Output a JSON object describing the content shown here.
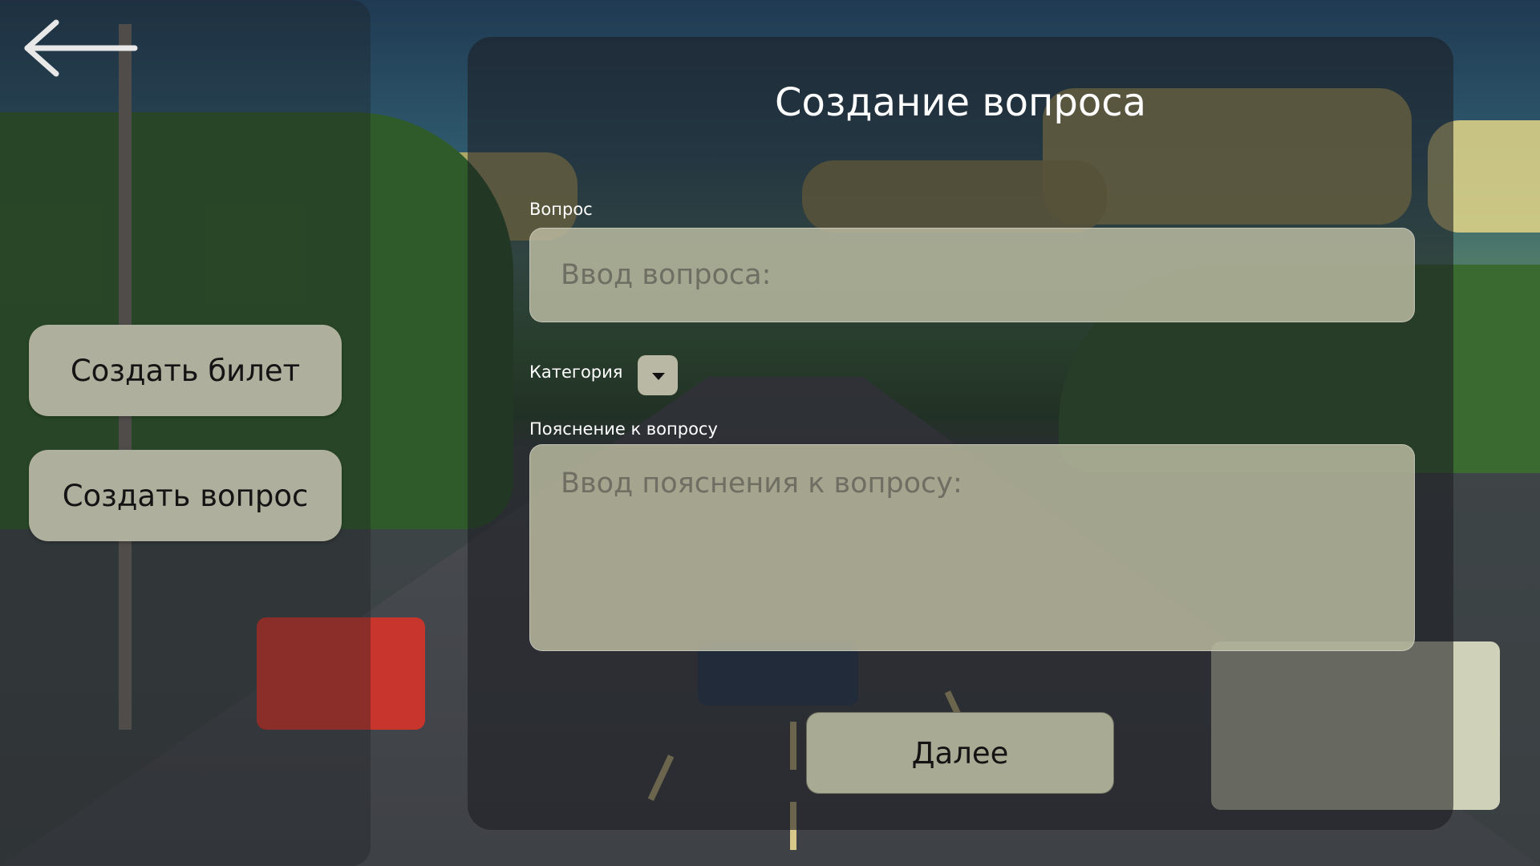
{
  "sidebar": {
    "back_icon": "arrow-left-icon",
    "buttons": [
      {
        "label": "Создать билет"
      },
      {
        "label": "Создать вопрос"
      }
    ]
  },
  "form": {
    "title": "Создание вопроса",
    "question": {
      "label": "Вопрос",
      "placeholder": "Ввод вопроса:",
      "value": ""
    },
    "category": {
      "label": "Категория",
      "dropdown_icon": "caret-down-icon"
    },
    "explanation": {
      "label": "Пояснение к вопросу",
      "placeholder": "Ввод пояснения к вопросу:",
      "value": ""
    },
    "next_label": "Далее"
  },
  "colors": {
    "button_bg": "#aeaf9c",
    "input_bg": "#bebea4",
    "panel_bg": "#1c1e22",
    "text_light": "#ffffff",
    "text_dark": "#141414"
  }
}
